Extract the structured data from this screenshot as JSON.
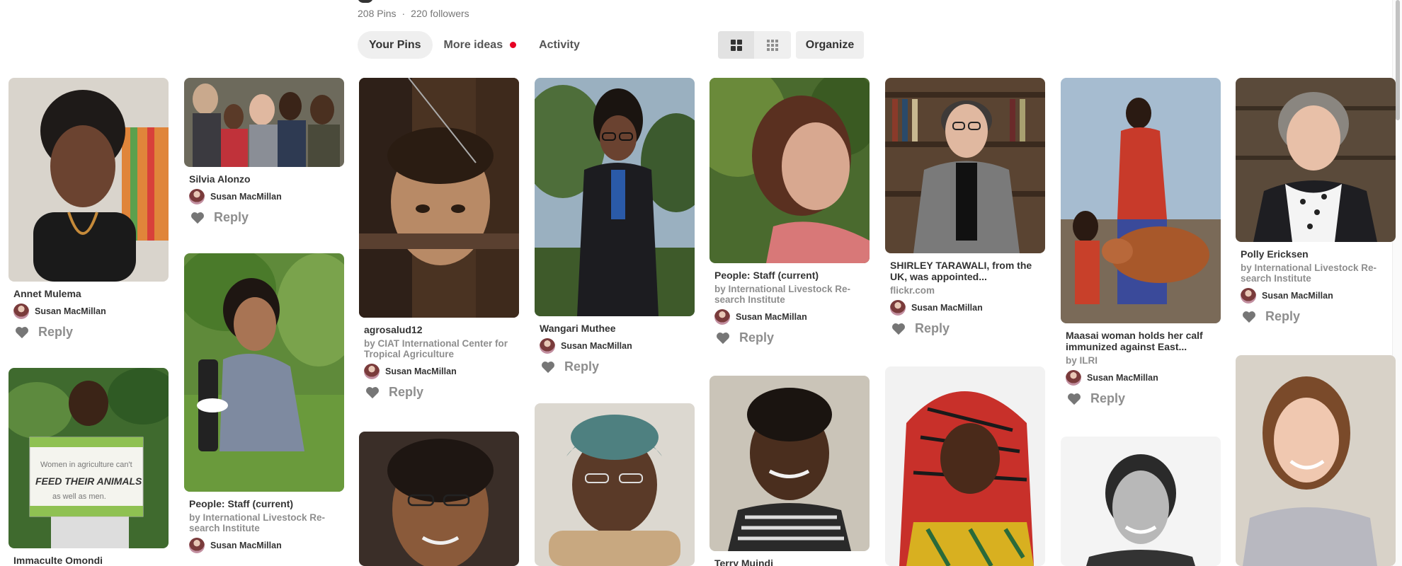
{
  "board": {
    "pins_count": "208 Pins",
    "separator": "·",
    "followers": "220 followers"
  },
  "tabs": [
    {
      "label": "Your Pins",
      "active": true
    },
    {
      "label": "More ideas",
      "has_dot": true
    },
    {
      "label": "Activity"
    }
  ],
  "view_toggle": {
    "grid_icon": "grid-large-icon",
    "compact_icon": "grid-small-icon"
  },
  "organize_label": "Organize",
  "reply_label": "Reply",
  "user_name": "Susan MacMillan",
  "colors": {
    "accent_red": "#e60023",
    "text_gray": "#8e8e8e",
    "tab_bg": "#efefef"
  },
  "pins": [
    {
      "title": "Annet Mulema",
      "subtitle": "",
      "user": "Susan MacMillan",
      "reply": "Reply"
    },
    {
      "title": "Immaculte Omondi",
      "subtitle": "",
      "user": "",
      "reply": ""
    },
    {
      "title": "Silvia Alonzo",
      "subtitle": "",
      "user": "Susan MacMillan",
      "reply": "Reply"
    },
    {
      "title": "People: Staff (current)",
      "subtitle": "by International Livestock Re-search Institute",
      "user": "Susan MacMillan",
      "reply": ""
    },
    {
      "title": "agrosalud12",
      "subtitle": "by CIAT International Center for Tropical Agriculture",
      "user": "Susan MacMillan",
      "reply": "Reply"
    },
    {
      "title": "",
      "subtitle": "",
      "user": "",
      "reply": ""
    },
    {
      "title": "Wangari Muthee",
      "subtitle": "",
      "user": "Susan MacMillan",
      "reply": "Reply"
    },
    {
      "title": "",
      "subtitle": "",
      "user": "",
      "reply": ""
    },
    {
      "title": "People: Staff (current)",
      "subtitle": "by International Livestock Re-search Institute",
      "user": "Susan MacMillan",
      "reply": "Reply"
    },
    {
      "title": "Terry Muindi",
      "subtitle": "",
      "user": "",
      "reply": ""
    },
    {
      "title": "SHIRLEY TARAWALI, from the UK, was appointed...",
      "subtitle": "flickr.com",
      "user": "Susan MacMillan",
      "reply": "Reply"
    },
    {
      "title": "",
      "subtitle": "",
      "user": "",
      "reply": ""
    },
    {
      "title": "Maasai woman holds her calf immunized against East...",
      "subtitle": "by ILRI",
      "user": "Susan MacMillan",
      "reply": "Reply"
    },
    {
      "title": "",
      "subtitle": "",
      "user": "",
      "reply": ""
    },
    {
      "title": "Polly Ericksen",
      "subtitle": "by International Livestock Re-search Institute",
      "user": "Susan MacMillan",
      "reply": "Reply"
    },
    {
      "title": "",
      "subtitle": "",
      "user": "",
      "reply": ""
    }
  ],
  "sign_text": {
    "line1": "Women in agriculture can't",
    "line2": "FEED THEIR ANIMALS",
    "line3": "as well as men."
  }
}
